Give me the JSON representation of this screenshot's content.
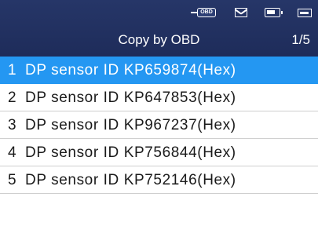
{
  "header": {
    "title": "Copy by OBD",
    "page_indicator": "1/5",
    "status_icons": {
      "obd": {
        "icon": "obd-connector-icon",
        "text": "OBD"
      },
      "mail": {
        "icon": "mail-icon"
      },
      "battery": {
        "icon": "battery-icon"
      },
      "display": {
        "icon": "display-icon"
      }
    }
  },
  "list": {
    "selected_index": 0,
    "items": [
      {
        "num": "1",
        "label": "DP sensor ID KP659874(Hex)"
      },
      {
        "num": "2",
        "label": "DP sensor ID KP647853(Hex)"
      },
      {
        "num": "3",
        "label": "DP sensor ID KP967237(Hex)"
      },
      {
        "num": "4",
        "label": "DP sensor ID KP756844(Hex)"
      },
      {
        "num": "5",
        "label": "DP sensor ID KP752146(Hex)"
      }
    ]
  },
  "colors": {
    "header_bg": "#22315f",
    "selected_bg": "#2497f2",
    "text": "#1a1a1a",
    "divider": "#cfcfcf"
  }
}
